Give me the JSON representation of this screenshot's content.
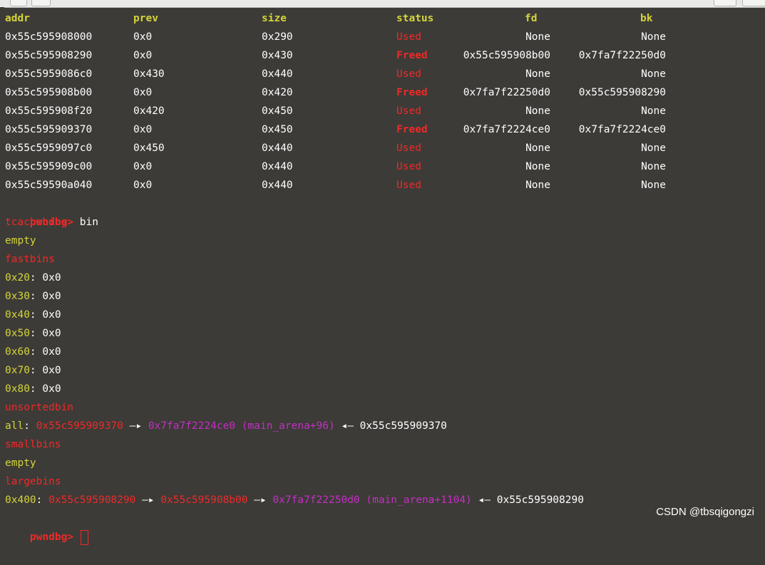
{
  "table": {
    "headers": {
      "addr": "addr",
      "prev": "prev",
      "size": "size",
      "status": "status",
      "fd": "fd",
      "bk": "bk"
    },
    "rows": [
      {
        "addr": "0x55c595908000",
        "prev": "0x0",
        "size": "0x290",
        "status": "Used",
        "fd": "None",
        "bk": "None"
      },
      {
        "addr": "0x55c595908290",
        "prev": "0x0",
        "size": "0x430",
        "status": "Freed",
        "fd": "0x55c595908b00",
        "bk": "0x7fa7f22250d0"
      },
      {
        "addr": "0x55c5959086c0",
        "prev": "0x430",
        "size": "0x440",
        "status": "Used",
        "fd": "None",
        "bk": "None"
      },
      {
        "addr": "0x55c595908b00",
        "prev": "0x0",
        "size": "0x420",
        "status": "Freed",
        "fd": "0x7fa7f22250d0",
        "bk": "0x55c595908290"
      },
      {
        "addr": "0x55c595908f20",
        "prev": "0x420",
        "size": "0x450",
        "status": "Used",
        "fd": "None",
        "bk": "None"
      },
      {
        "addr": "0x55c595909370",
        "prev": "0x0",
        "size": "0x450",
        "status": "Freed",
        "fd": "0x7fa7f2224ce0",
        "bk": "0x7fa7f2224ce0"
      },
      {
        "addr": "0x55c5959097c0",
        "prev": "0x450",
        "size": "0x440",
        "status": "Used",
        "fd": "None",
        "bk": "None"
      },
      {
        "addr": "0x55c595909c00",
        "prev": "0x0",
        "size": "0x440",
        "status": "Used",
        "fd": "None",
        "bk": "None"
      },
      {
        "addr": "0x55c59590a040",
        "prev": "0x0",
        "size": "0x440",
        "status": "Used",
        "fd": "None",
        "bk": "None"
      }
    ]
  },
  "prompt": {
    "text": "pwndbg>",
    "command": "bin"
  },
  "tcache": {
    "title": "tcachebins",
    "value": "empty"
  },
  "fastbins": {
    "title": "fastbins",
    "sep": ":",
    "entries": [
      {
        "size": "0x20",
        "value": "0x0"
      },
      {
        "size": "0x30",
        "value": "0x0"
      },
      {
        "size": "0x40",
        "value": "0x0"
      },
      {
        "size": "0x50",
        "value": "0x0"
      },
      {
        "size": "0x60",
        "value": "0x0"
      },
      {
        "size": "0x70",
        "value": "0x0"
      },
      {
        "size": "0x80",
        "value": "0x0"
      }
    ]
  },
  "unsorted": {
    "title": "unsortedbin",
    "label": "all",
    "sep": ":",
    "chunk": "0x55c595909370",
    "arrow_r": "—▸",
    "arena": "0x7fa7f2224ce0 (main_arena+96)",
    "arrow_l": "◂—",
    "back": "0x55c595909370"
  },
  "smallbins": {
    "title": "smallbins",
    "value": "empty"
  },
  "largebins": {
    "title": "largebins",
    "label": "0x400",
    "sep": ":",
    "chunk1": "0x55c595908290",
    "arrow_r": "—▸",
    "chunk2": "0x55c595908b00",
    "arena": "0x7fa7f22250d0 (main_arena+1104)",
    "arrow_l": "◂—",
    "back": "0x55c595908290"
  },
  "watermark": "CSDN @tbsqigongzi",
  "colors": {
    "background": "#3c3b37",
    "header_yellow": "#d4d43a",
    "status_red": "#ef2929",
    "arena_magenta": "#c42fc4"
  }
}
